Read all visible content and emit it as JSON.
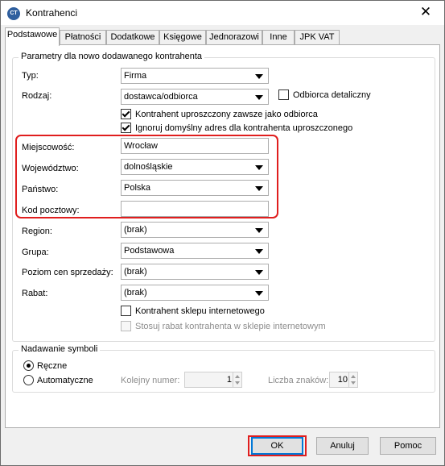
{
  "window": {
    "title": "Kontrahenci",
    "app_icon_text": "CT"
  },
  "tabs": [
    {
      "label": "Podstawowe",
      "active": true
    },
    {
      "label": "Płatności"
    },
    {
      "label": "Dodatkowe"
    },
    {
      "label": "Księgowe"
    },
    {
      "label": "Jednorazowi"
    },
    {
      "label": "Inne"
    },
    {
      "label": "JPK VAT"
    }
  ],
  "params": {
    "legend": "Parametry dla nowo dodawanego kontrahenta",
    "typ": {
      "label": "Typ:",
      "value": "Firma"
    },
    "rodzaj": {
      "label": "Rodzaj:",
      "value": "dostawca/odbiorca"
    },
    "odbiorca_detaliczny": {
      "label": "Odbiorca detaliczny",
      "checked": false
    },
    "uproszczony_odbiorca": {
      "label": "Kontrahent uproszczony zawsze jako odbiorca",
      "checked": true
    },
    "ignoruj_adres": {
      "label": "Ignoruj domyślny adres dla kontrahenta uproszczonego",
      "checked": true
    },
    "miejscowosc": {
      "label": "Miejscowość:",
      "value": "Wrocław"
    },
    "wojewodztwo": {
      "label": "Województwo:",
      "value": "dolnośląskie"
    },
    "panstwo": {
      "label": "Państwo:",
      "value": "Polska"
    },
    "kod": {
      "label": "Kod pocztowy:",
      "value": ""
    },
    "region": {
      "label": "Region:",
      "value": "(brak)"
    },
    "grupa": {
      "label": "Grupa:",
      "value": "Podstawowa"
    },
    "poziom_cen": {
      "label": "Poziom cen sprzedaży:",
      "value": "(brak)"
    },
    "rabat": {
      "label": "Rabat:",
      "value": "(brak)"
    },
    "sklep": {
      "label": "Kontrahent sklepu internetowego",
      "checked": false
    },
    "rabat_sklep": {
      "label": "Stosuj rabat kontrahenta w sklepie internetowym",
      "checked": false,
      "disabled": true
    }
  },
  "symbols": {
    "legend": "Nadawanie symboli",
    "reczne": {
      "label": "Ręczne",
      "selected": true
    },
    "automatyczne": {
      "label": "Automatyczne",
      "selected": false
    },
    "kolejny_numer": {
      "label": "Kolejny numer:",
      "value": "1"
    },
    "liczba_znakow": {
      "label": "Liczba znaków:",
      "value": "10"
    }
  },
  "buttons": {
    "ok": "OK",
    "cancel": "Anuluj",
    "help": "Pomoc"
  },
  "colors": {
    "highlight": "#e01e1e",
    "focus": "#0078d7"
  }
}
